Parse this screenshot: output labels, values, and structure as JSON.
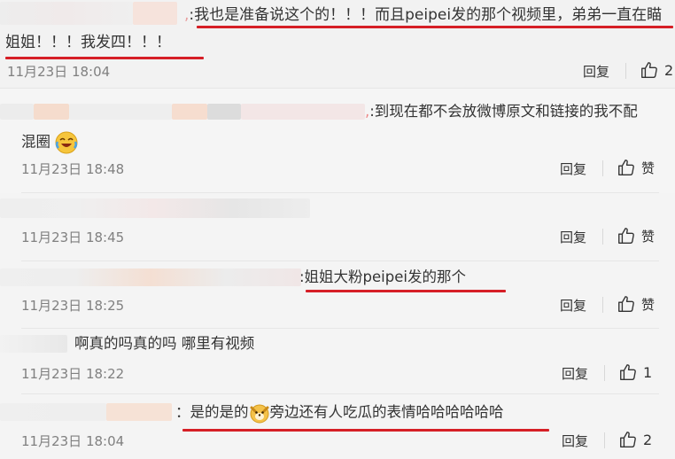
{
  "comments": [
    {
      "prefix": ":",
      "line1": "我也是准备说这个的！！！而且peipei发的那个视频里，弟弟一直在瞄",
      "line2": "姐姐！！！我发四！！！",
      "time": "11月23日 18:04",
      "reply": "回复",
      "like": "2"
    },
    {
      "line1": ":到现在都不会放微博原文和链接的我不配",
      "line2": "混圈",
      "time": "11月23日 18:48",
      "reply": "回复",
      "like": "赞"
    },
    {
      "time": "11月23日 18:45",
      "reply": "回复",
      "like": "赞"
    },
    {
      "line1": ":姐姐大粉peipei发的那个",
      "time": "11月23日 18:25",
      "reply": "回复",
      "like": "赞"
    },
    {
      "line1": "啊真的吗真的吗 哪里有视频",
      "time": "11月23日 18:22",
      "reply": "回复",
      "like": "1"
    },
    {
      "prefix": "：",
      "line1a": "是的是的",
      "line1b": "旁边还有人吃瓜的表情哈哈哈哈哈哈",
      "time": "11月23日 18:04",
      "reply": "回复",
      "like": "2"
    }
  ],
  "colors": {
    "underline": "#d61f26",
    "background": "#f4f4f4",
    "meta": "#808080"
  },
  "icons": [
    "thumbs-up-icon",
    "laughing-emoji-icon",
    "dog-emoji-icon"
  ]
}
